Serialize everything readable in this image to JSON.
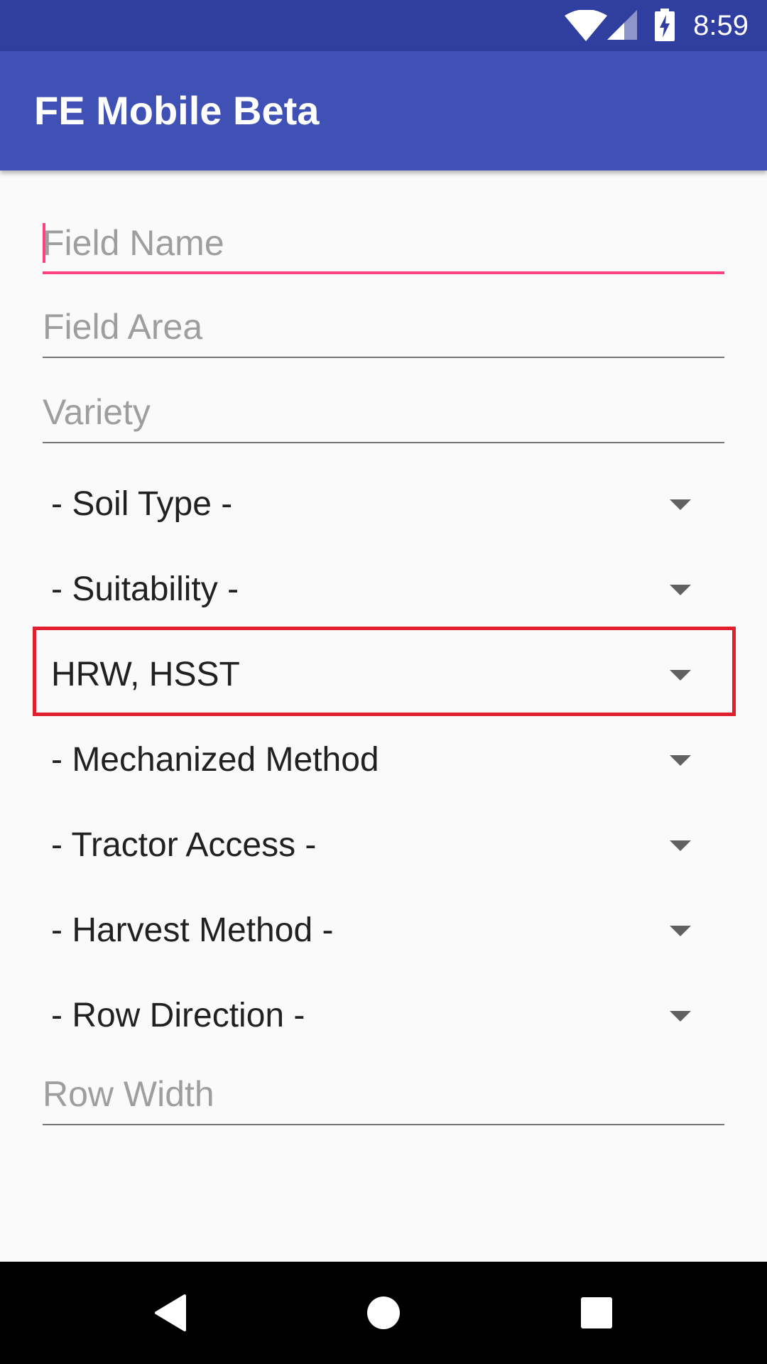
{
  "status_bar": {
    "time": "8:59",
    "icons": [
      "wifi-icon",
      "cell-signal-icon",
      "battery-charging-icon"
    ],
    "background": "#303F9F"
  },
  "app_bar": {
    "title": "FE Mobile Beta",
    "background": "#3F51B5"
  },
  "form": {
    "field_name": {
      "placeholder": "Field Name",
      "value": "",
      "focused": true
    },
    "field_area": {
      "placeholder": "Field Area",
      "value": ""
    },
    "variety": {
      "placeholder": "Variety",
      "value": ""
    },
    "soil_type": {
      "selected": "- Soil Type -"
    },
    "suitability": {
      "selected": "- Suitability -"
    },
    "hrw_hsst": {
      "selected": "HRW, HSST",
      "highlighted": true
    },
    "mechanized_method": {
      "selected": "- Mechanized Method"
    },
    "tractor_access": {
      "selected": "- Tractor Access -"
    },
    "harvest_method": {
      "selected": "- Harvest Method -"
    },
    "row_direction": {
      "selected": "- Row Direction -"
    },
    "row_width": {
      "placeholder": "Row Width",
      "value": ""
    }
  },
  "nav_bar": {
    "buttons": [
      "back-icon",
      "home-icon",
      "recents-icon"
    ]
  },
  "colors": {
    "accent": "#FF4081",
    "highlight": "#E0202E",
    "hint": "#9E9E9E",
    "text": "#212121"
  }
}
